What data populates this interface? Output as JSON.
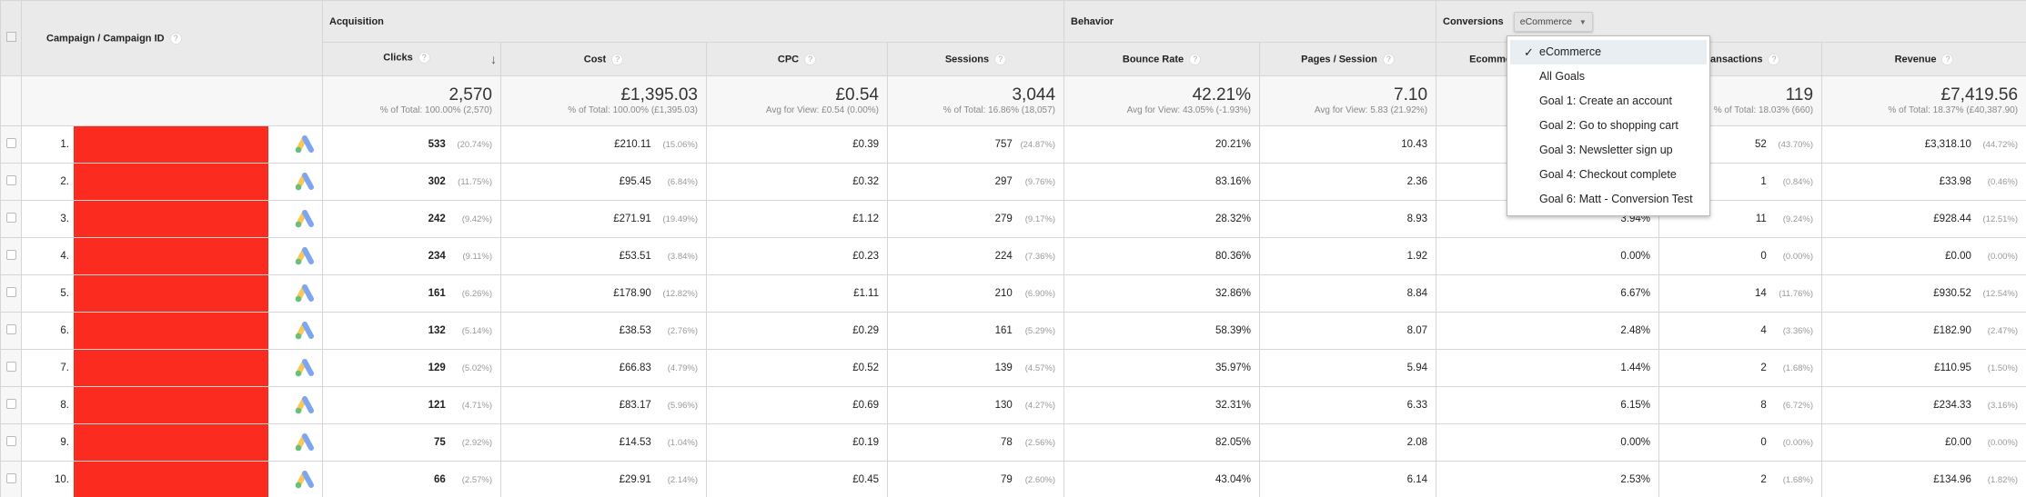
{
  "header": {
    "dimension": "Campaign / Campaign ID",
    "groups": {
      "acquisition": "Acquisition",
      "behavior": "Behavior",
      "conversions": "Conversions"
    },
    "conversion_select": {
      "selected": "eCommerce",
      "options": [
        "eCommerce",
        "All Goals",
        "Goal 1: Create an account",
        "Goal 2: Go to shopping cart",
        "Goal 3: Newsletter sign up",
        "Goal 4: Checkout complete",
        "Goal 6: Matt - Conversion Test"
      ]
    },
    "columns": {
      "clicks": "Clicks",
      "cost": "Cost",
      "cpc": "CPC",
      "sessions": "Sessions",
      "bounce": "Bounce Rate",
      "pages": "Pages / Session",
      "ecr": "Ecommerce Conversion Rate",
      "transactions": "Transactions",
      "revenue": "Revenue"
    },
    "help_glyph": "?",
    "sort_glyph": "↓"
  },
  "summary": {
    "clicks": {
      "value": "2,570",
      "sub": "% of Total: 100.00% (2,570)"
    },
    "cost": {
      "value": "£1,395.03",
      "sub": "% of Total: 100.00% (£1,395.03)"
    },
    "cpc": {
      "value": "£0.54",
      "sub": "Avg for View: £0.54 (0.00%)"
    },
    "sessions": {
      "value": "3,044",
      "sub": "% of Total: 16.86% (18,057)"
    },
    "bounce": {
      "value": "42.21%",
      "sub": "Avg for View: 43.05% (-1.93%)"
    },
    "pages": {
      "value": "7.10",
      "sub": "Avg for View: 5.83 (21.92%)"
    },
    "ecr": {
      "value": "",
      "sub": ""
    },
    "transactions": {
      "value": "119",
      "sub": "% of Total: 18.03% (660)"
    },
    "revenue": {
      "value": "£7,419.56",
      "sub": "% of Total: 18.37% (£40,387.90)"
    }
  },
  "rows": [
    {
      "idx": "1.",
      "clicks": "533",
      "clicks_pct": "(20.74%)",
      "cost": "£210.11",
      "cost_pct": "(15.06%)",
      "cpc": "£0.39",
      "sessions": "757",
      "sessions_pct": "(24.87%)",
      "bounce": "20.21%",
      "pages": "10.43",
      "ecr": "",
      "transactions": "52",
      "transactions_pct": "(43.70%)",
      "revenue": "£3,318.10",
      "revenue_pct": "(44.72%)"
    },
    {
      "idx": "2.",
      "clicks": "302",
      "clicks_pct": "(11.75%)",
      "cost": "£95.45",
      "cost_pct": "(6.84%)",
      "cpc": "£0.32",
      "sessions": "297",
      "sessions_pct": "(9.76%)",
      "bounce": "83.16%",
      "pages": "2.36",
      "ecr": "",
      "transactions": "1",
      "transactions_pct": "(0.84%)",
      "revenue": "£33.98",
      "revenue_pct": "(0.46%)"
    },
    {
      "idx": "3.",
      "clicks": "242",
      "clicks_pct": "(9.42%)",
      "cost": "£271.91",
      "cost_pct": "(19.49%)",
      "cpc": "£1.12",
      "sessions": "279",
      "sessions_pct": "(9.17%)",
      "bounce": "28.32%",
      "pages": "8.93",
      "ecr": "3.94%",
      "transactions": "11",
      "transactions_pct": "(9.24%)",
      "revenue": "£928.44",
      "revenue_pct": "(12.51%)"
    },
    {
      "idx": "4.",
      "clicks": "234",
      "clicks_pct": "(9.11%)",
      "cost": "£53.51",
      "cost_pct": "(3.84%)",
      "cpc": "£0.23",
      "sessions": "224",
      "sessions_pct": "(7.36%)",
      "bounce": "80.36%",
      "pages": "1.92",
      "ecr": "0.00%",
      "transactions": "0",
      "transactions_pct": "(0.00%)",
      "revenue": "£0.00",
      "revenue_pct": "(0.00%)"
    },
    {
      "idx": "5.",
      "clicks": "161",
      "clicks_pct": "(6.26%)",
      "cost": "£178.90",
      "cost_pct": "(12.82%)",
      "cpc": "£1.11",
      "sessions": "210",
      "sessions_pct": "(6.90%)",
      "bounce": "32.86%",
      "pages": "8.84",
      "ecr": "6.67%",
      "transactions": "14",
      "transactions_pct": "(11.76%)",
      "revenue": "£930.52",
      "revenue_pct": "(12.54%)"
    },
    {
      "idx": "6.",
      "clicks": "132",
      "clicks_pct": "(5.14%)",
      "cost": "£38.53",
      "cost_pct": "(2.76%)",
      "cpc": "£0.29",
      "sessions": "161",
      "sessions_pct": "(5.29%)",
      "bounce": "58.39%",
      "pages": "8.07",
      "ecr": "2.48%",
      "transactions": "4",
      "transactions_pct": "(3.36%)",
      "revenue": "£182.90",
      "revenue_pct": "(2.47%)"
    },
    {
      "idx": "7.",
      "clicks": "129",
      "clicks_pct": "(5.02%)",
      "cost": "£66.83",
      "cost_pct": "(4.79%)",
      "cpc": "£0.52",
      "sessions": "139",
      "sessions_pct": "(4.57%)",
      "bounce": "35.97%",
      "pages": "5.94",
      "ecr": "1.44%",
      "transactions": "2",
      "transactions_pct": "(1.68%)",
      "revenue": "£110.95",
      "revenue_pct": "(1.50%)"
    },
    {
      "idx": "8.",
      "clicks": "121",
      "clicks_pct": "(4.71%)",
      "cost": "£83.17",
      "cost_pct": "(5.96%)",
      "cpc": "£0.69",
      "sessions": "130",
      "sessions_pct": "(4.27%)",
      "bounce": "32.31%",
      "pages": "6.33",
      "ecr": "6.15%",
      "transactions": "8",
      "transactions_pct": "(6.72%)",
      "revenue": "£234.33",
      "revenue_pct": "(3.16%)"
    },
    {
      "idx": "9.",
      "clicks": "75",
      "clicks_pct": "(2.92%)",
      "cost": "£14.53",
      "cost_pct": "(1.04%)",
      "cpc": "£0.19",
      "sessions": "78",
      "sessions_pct": "(2.56%)",
      "bounce": "82.05%",
      "pages": "2.08",
      "ecr": "0.00%",
      "transactions": "0",
      "transactions_pct": "(0.00%)",
      "revenue": "£0.00",
      "revenue_pct": "(0.00%)"
    },
    {
      "idx": "10.",
      "clicks": "66",
      "clicks_pct": "(2.57%)",
      "cost": "£29.91",
      "cost_pct": "(2.14%)",
      "cpc": "£0.45",
      "sessions": "79",
      "sessions_pct": "(2.60%)",
      "bounce": "43.04%",
      "pages": "6.14",
      "ecr": "2.53%",
      "transactions": "2",
      "transactions_pct": "(1.68%)",
      "revenue": "£134.96",
      "revenue_pct": "(1.82%)"
    }
  ],
  "colors": {
    "redaction": "#fc2b1f",
    "header_bg": "#eaeaea",
    "summary_bg": "#f7f7f7",
    "dropdown_selected_bg": "#e8eef2",
    "ads_blue": "#7ca6f2",
    "ads_yellow": "#f8c95a",
    "ads_green": "#6bbf7d"
  },
  "icons": {
    "check": "✓",
    "caret": "▼"
  }
}
